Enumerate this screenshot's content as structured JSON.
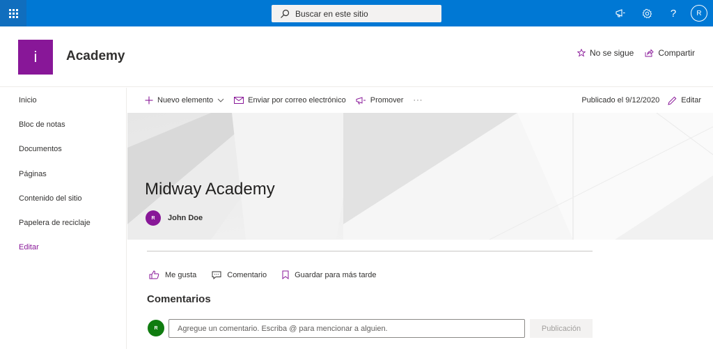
{
  "suitebar": {
    "search_placeholder": "Buscar en este sitio",
    "user_initial": "R",
    "help_label": "?"
  },
  "site": {
    "logo_letter": "i",
    "title": "Academy",
    "follow_label": "No se sigue",
    "share_label": "Compartir"
  },
  "nav": {
    "items": [
      {
        "label": "Inicio"
      },
      {
        "label": "Bloc de notas"
      },
      {
        "label": "Documentos"
      },
      {
        "label": "Páginas"
      },
      {
        "label": "Contenido del sitio"
      },
      {
        "label": "Papelera de reciclaje"
      }
    ],
    "edit_label": "Editar"
  },
  "commandbar": {
    "new_label": "Nuevo elemento",
    "email_label": "Enviar por correo electrónico",
    "promote_label": "Promover",
    "more_label": "···",
    "published_label": "Publicado el 9/12/2020",
    "edit_label": "Editar"
  },
  "hero": {
    "title": "Midway Academy",
    "author_initial": "R",
    "author_name": "John Doe"
  },
  "social": {
    "like_label": "Me gusta",
    "comment_label": "Comentario",
    "save_label": "Guardar para más tarde"
  },
  "comments": {
    "title": "Comentarios",
    "user_initial": "R",
    "input_placeholder": "Agregue un comentario. Escriba @ para mencionar a alguien.",
    "post_label": "Publicación"
  },
  "colors": {
    "suitebar": "#0078d4",
    "brand": "#881798",
    "comment_avatar": "#107c10"
  }
}
